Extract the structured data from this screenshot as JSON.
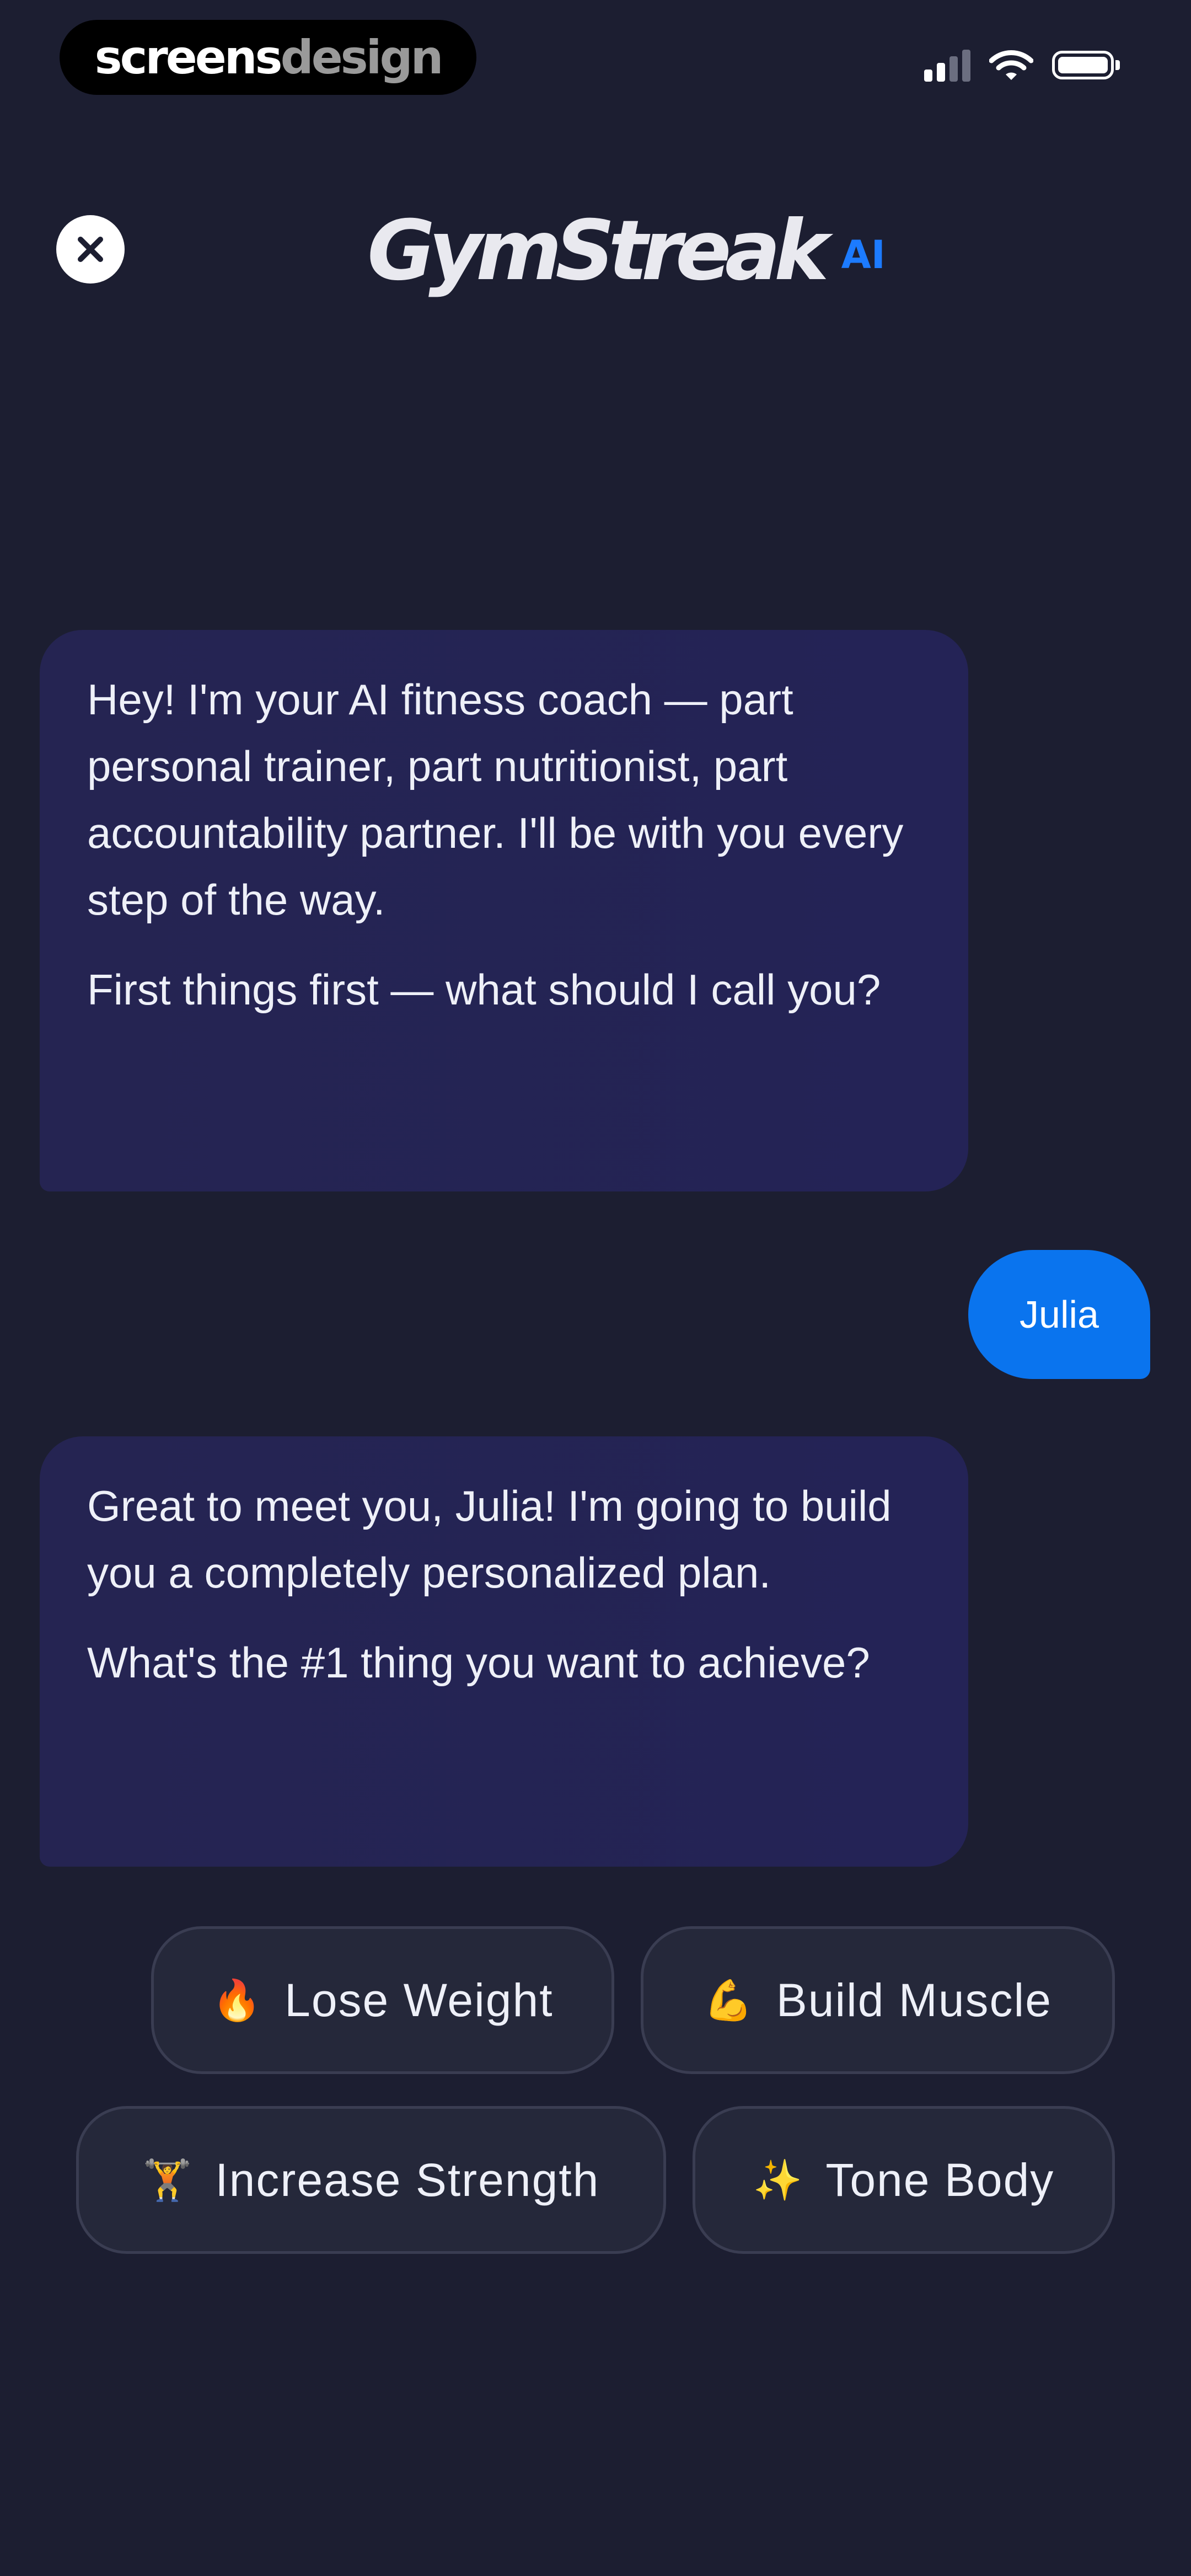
{
  "watermark": {
    "part1": "screens",
    "part2": "design"
  },
  "header": {
    "brand": "GymStreak",
    "badge": "AI"
  },
  "icons": {
    "close": "close-icon",
    "wifi": "wifi-icon",
    "signal": "cellular-signal-icon",
    "battery": "battery-icon"
  },
  "colors": {
    "background": "#1c1e31",
    "ai_bubble": "#252452",
    "user_bubble": "#0a74ee",
    "accent": "#1c7bff",
    "chip_bg": "#25283a"
  },
  "chat": {
    "ai_message_1": {
      "p1": "Hey! I'm your AI fitness coach — part personal trainer, part nutritionist, part accountability partner. I'll be with you every step of the way.",
      "p2": "First things first — what should I call you?"
    },
    "user_message": "Julia",
    "ai_message_2": {
      "p1": "Great to meet you, Julia! I'm going to build you a completely personalized plan.",
      "p2": "What's the #1 thing you want to achieve?"
    }
  },
  "options": [
    {
      "emoji": "🔥",
      "label": "Lose Weight",
      "icon": "fire-icon"
    },
    {
      "emoji": "💪",
      "label": "Build Muscle",
      "icon": "flexed-biceps-icon"
    },
    {
      "emoji": "🏋️",
      "label": "Increase Strength",
      "icon": "weightlifter-icon"
    },
    {
      "emoji": "✨",
      "label": "Tone Body",
      "icon": "sparkles-icon"
    }
  ]
}
